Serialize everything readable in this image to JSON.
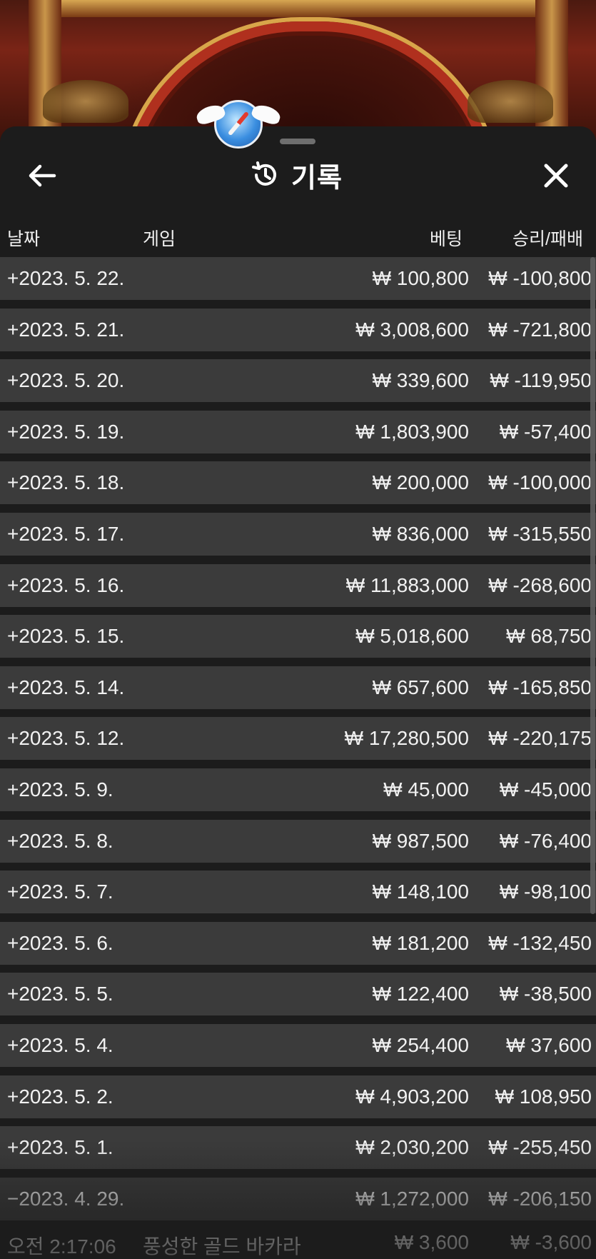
{
  "sheet": {
    "title": "기록",
    "back_icon": "arrow-left-icon",
    "close_icon": "close-icon",
    "history_icon": "history-icon"
  },
  "columns": {
    "date": "날짜",
    "game": "게임",
    "bet": "베팅",
    "win_loss": "승리/패배"
  },
  "rows": [
    {
      "date": "+2023. 5. 22.",
      "bet": "₩ 100,800",
      "result": "₩ -100,800"
    },
    {
      "date": "+2023. 5. 21.",
      "bet": "₩ 3,008,600",
      "result": "₩ -721,800"
    },
    {
      "date": "+2023. 5. 20.",
      "bet": "₩ 339,600",
      "result": "₩ -119,950"
    },
    {
      "date": "+2023. 5. 19.",
      "bet": "₩ 1,803,900",
      "result": "₩ -57,400"
    },
    {
      "date": "+2023. 5. 18.",
      "bet": "₩ 200,000",
      "result": "₩ -100,000"
    },
    {
      "date": "+2023. 5. 17.",
      "bet": "₩ 836,000",
      "result": "₩ -315,550"
    },
    {
      "date": "+2023. 5. 16.",
      "bet": "₩ 11,883,000",
      "result": "₩ -268,600"
    },
    {
      "date": "+2023. 5. 15.",
      "bet": "₩ 5,018,600",
      "result": "₩ 68,750"
    },
    {
      "date": "+2023. 5. 14.",
      "bet": "₩ 657,600",
      "result": "₩ -165,850"
    },
    {
      "date": "+2023. 5. 12.",
      "bet": "₩ 17,280,500",
      "result": "₩ -220,175"
    },
    {
      "date": "+2023. 5. 9.",
      "bet": "₩ 45,000",
      "result": "₩ -45,000"
    },
    {
      "date": "+2023. 5. 8.",
      "bet": "₩ 987,500",
      "result": "₩ -76,400"
    },
    {
      "date": "+2023. 5. 7.",
      "bet": "₩ 148,100",
      "result": "₩ -98,100"
    },
    {
      "date": "+2023. 5. 6.",
      "bet": "₩ 181,200",
      "result": "₩ -132,450"
    },
    {
      "date": "+2023. 5. 5.",
      "bet": "₩ 122,400",
      "result": "₩ -38,500"
    },
    {
      "date": "+2023. 5. 4.",
      "bet": "₩ 254,400",
      "result": "₩ 37,600"
    },
    {
      "date": "+2023. 5. 2.",
      "bet": "₩ 4,903,200",
      "result": "₩ 108,950"
    },
    {
      "date": "+2023. 5. 1.",
      "bet": "₩ 2,030,200",
      "result": "₩ -255,450"
    },
    {
      "date": "−2023. 4. 29.",
      "bet": "₩ 1,272,000",
      "result": "₩ -206,150"
    }
  ],
  "sub_row": {
    "time": "오전 2:17:06",
    "game": "풍성한 골드 바카라",
    "bet": "₩ 3,600",
    "result": "₩ -3,600"
  }
}
